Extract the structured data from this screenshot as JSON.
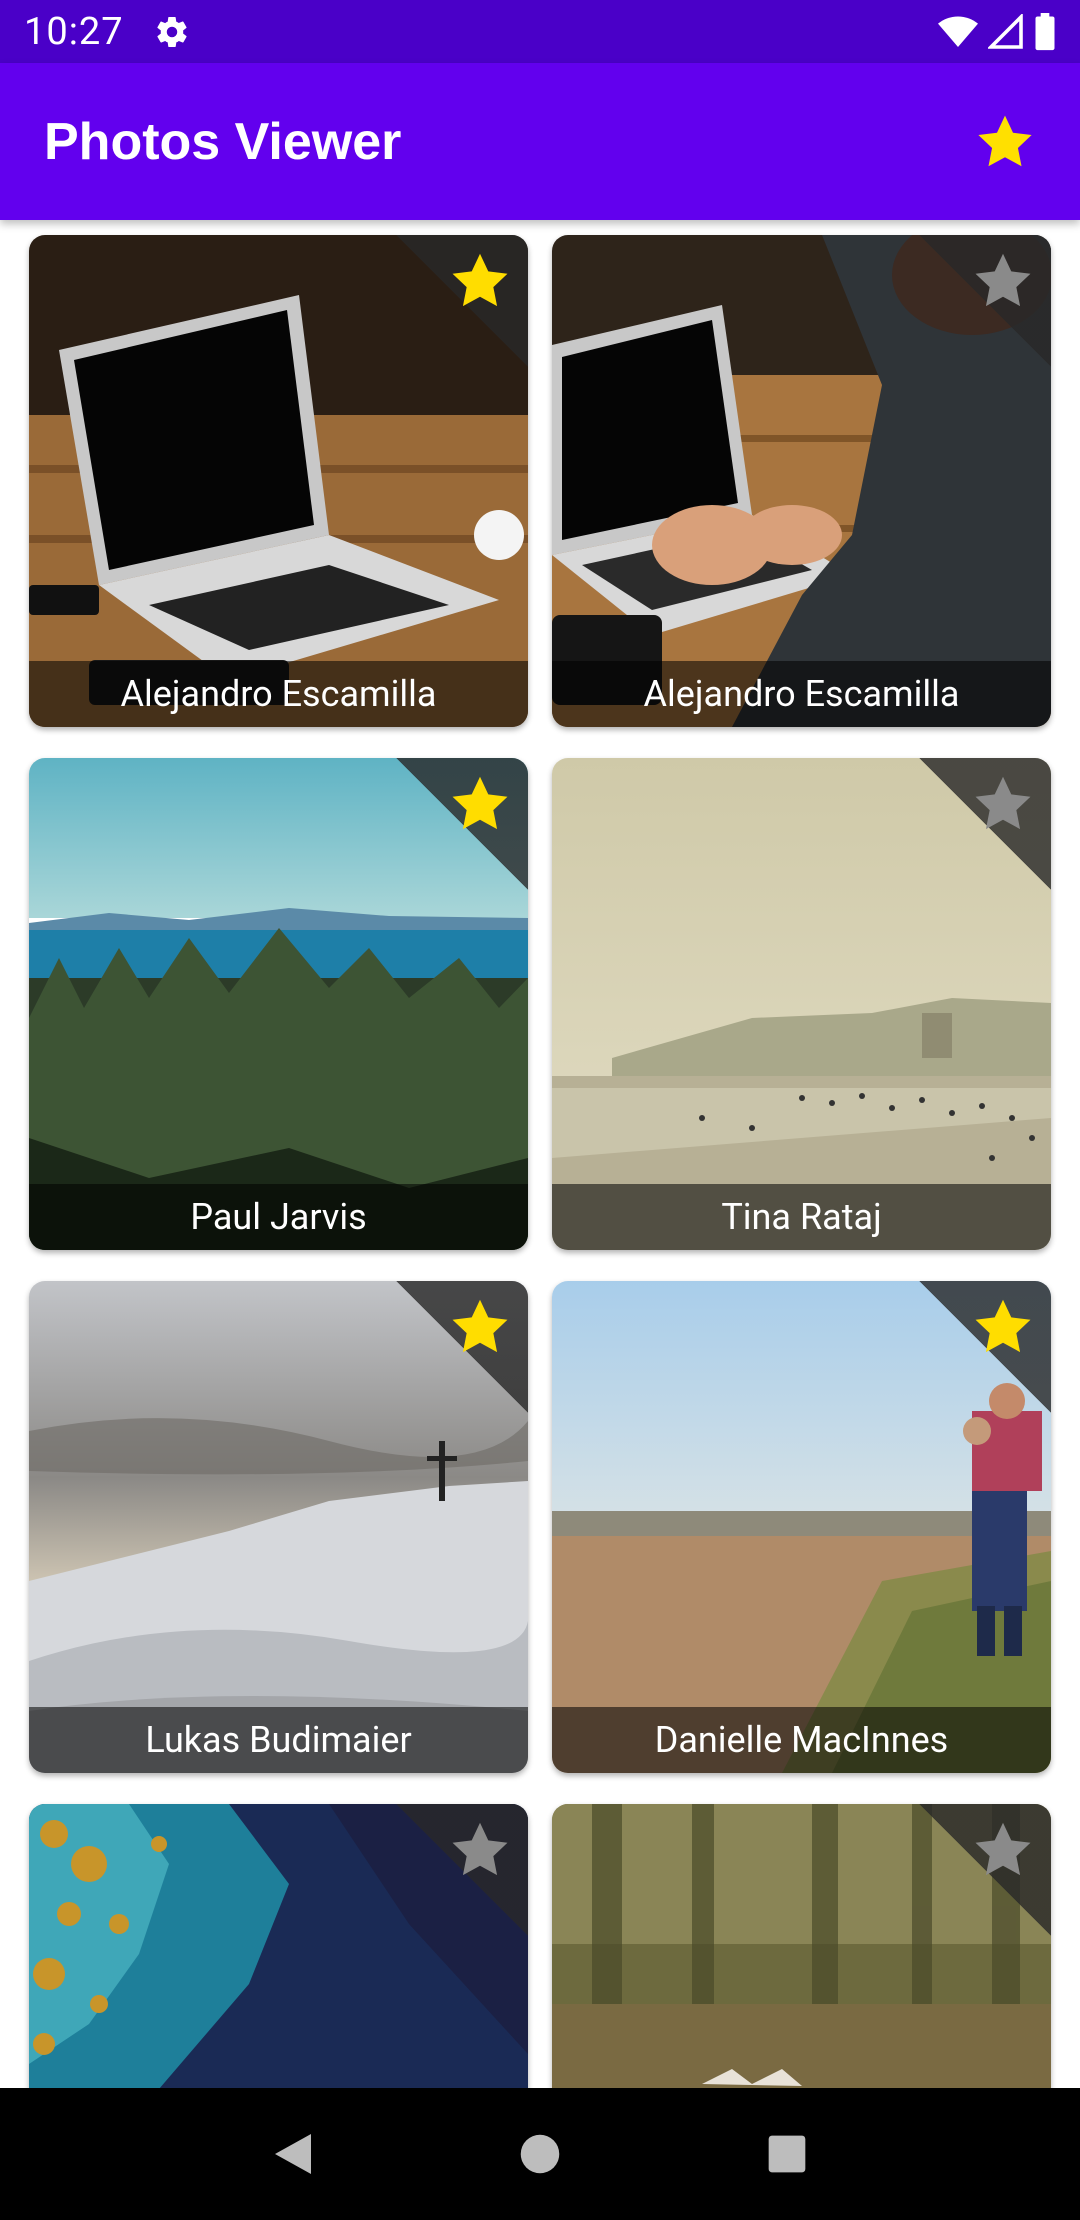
{
  "status_bar": {
    "time": "10:27",
    "icons": [
      "gear-icon",
      "wifi-icon",
      "signal-icon",
      "battery-icon"
    ]
  },
  "app_bar": {
    "title": "Photos Viewer",
    "action_icon": "star-icon"
  },
  "photos": [
    {
      "author": "Alejandro Escamilla",
      "favorite": true,
      "scene": "laptop-on-table"
    },
    {
      "author": "Alejandro Escamilla",
      "favorite": false,
      "scene": "person-typing-laptop"
    },
    {
      "author": "Paul Jarvis",
      "favorite": true,
      "scene": "forest-sea-mountains"
    },
    {
      "author": "Tina Rataj",
      "favorite": false,
      "scene": "hazy-beach"
    },
    {
      "author": "Lukas Budimaier",
      "favorite": true,
      "scene": "snowy-hill-cross"
    },
    {
      "author": "Danielle MacInnes",
      "favorite": true,
      "scene": "beach-father-child"
    },
    {
      "author": "",
      "favorite": false,
      "scene": "aerial-coast-satellite"
    },
    {
      "author": "",
      "favorite": false,
      "scene": "blurred-forest"
    }
  ],
  "colors": {
    "status_bar": "#4a00c8",
    "app_bar": "#6200ee",
    "star_active": "#ffdd00",
    "star_inactive": "#8a8a8a"
  },
  "nav_bar": {
    "icons": [
      "back-icon",
      "home-icon",
      "recents-icon"
    ]
  }
}
